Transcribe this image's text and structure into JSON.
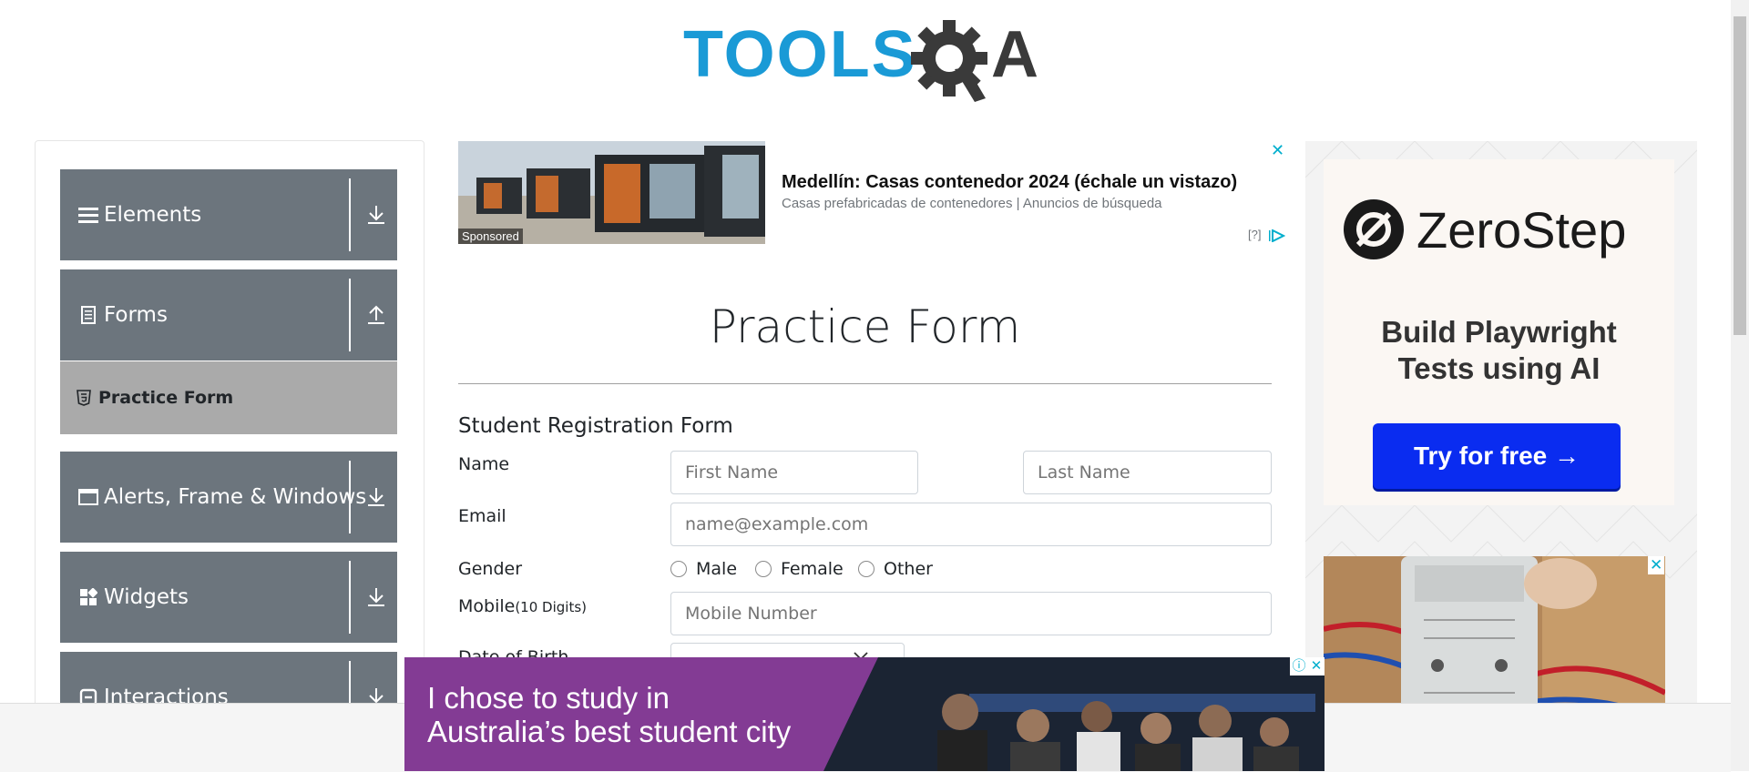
{
  "logo": {
    "left": "TOOLS",
    "right": "A"
  },
  "sidebar": {
    "groups": [
      {
        "label": "Elements",
        "icon": "hamburger-icon",
        "arrow": "download-icon"
      },
      {
        "label": "Forms",
        "icon": "document-icon",
        "arrow": "upload-icon"
      },
      {
        "label": "Alerts, Frame & Windows",
        "icon": "window-icon",
        "arrow": "download-icon"
      },
      {
        "label": "Widgets",
        "icon": "widgets-icon",
        "arrow": "download-icon"
      },
      {
        "label": "Interactions",
        "icon": "interactions-icon",
        "arrow": "download-icon"
      }
    ],
    "subitem": {
      "label": "Practice Form",
      "icon": "html5-icon"
    }
  },
  "ad_top": {
    "title": "Medellín: Casas contenedor 2024 (échale un vistazo)",
    "subtitle": "Casas prefabricadas de contenedores | Anuncios de búsqueda",
    "badge": "Sponsored",
    "info": "[?]",
    "close": "✕"
  },
  "form": {
    "page_title": "Practice Form",
    "heading": "Student Registration Form",
    "name_label": "Name",
    "first_name_placeholder": "First Name",
    "last_name_placeholder": "Last Name",
    "email_label": "Email",
    "email_placeholder": "name@example.com",
    "gender_label": "Gender",
    "gender_options": [
      "Male",
      "Female",
      "Other"
    ],
    "mobile_label": "Mobile",
    "mobile_hint": "(10 Digits)",
    "mobile_placeholder": "Mobile Number",
    "dob_label": "Date of Birth"
  },
  "ad_right": {
    "brand": "ZeroStep",
    "tagline_1": "Build Playwright",
    "tagline_2": "Tests using AI",
    "cta": "Try for free →",
    "close": "✕"
  },
  "ad_bottom": {
    "line1": "I chose to study in",
    "line2": "Australia’s best student city",
    "close": "✕",
    "info": "ⓘ"
  },
  "colors": {
    "sidebar_group": "#6c757d",
    "sidebar_active": "#aaaaaa",
    "logo_blue": "#1a9ad6",
    "logo_dark": "#3a3a3a",
    "cta_blue": "#0a2cf0",
    "ad_purple": "#833b94"
  }
}
